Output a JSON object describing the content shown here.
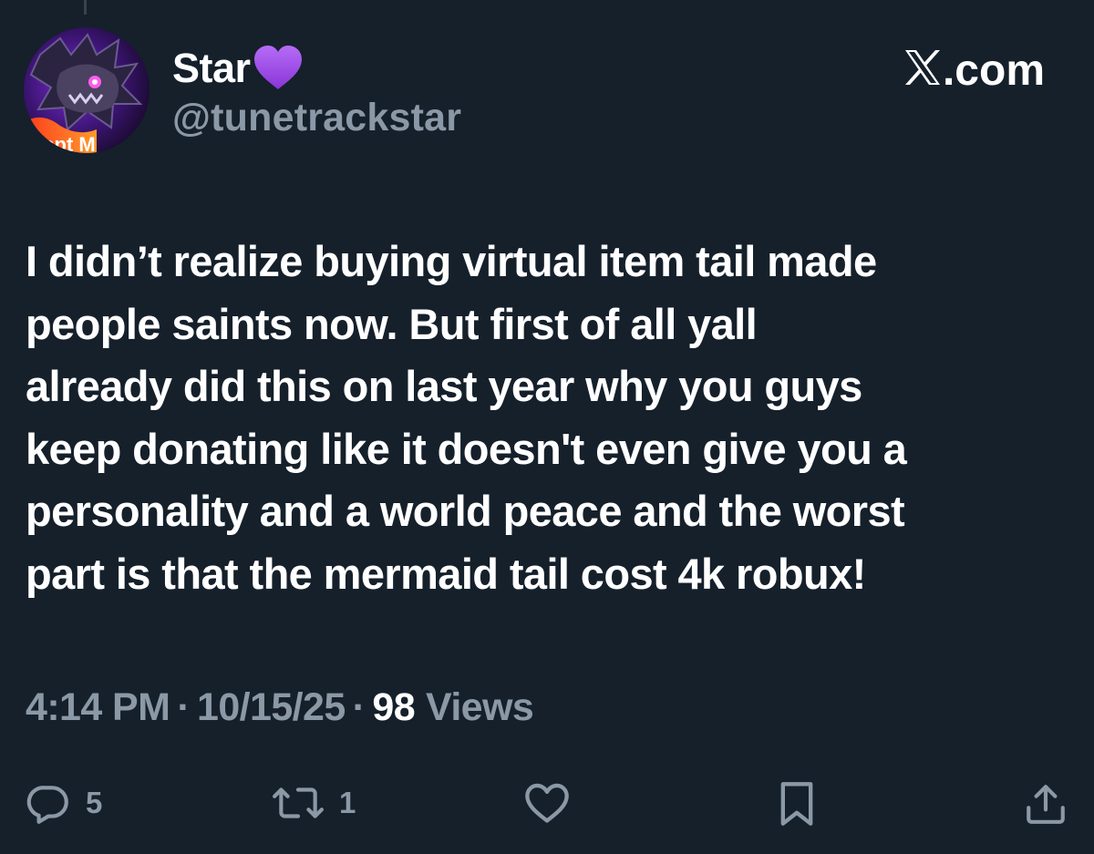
{
  "author": {
    "display_name": "Star",
    "name_emoji": "purple-heart-emoji",
    "handle": "@tunetrackstar",
    "avatar": "avatar-image"
  },
  "site": {
    "label": ".com",
    "logo": "x-logo"
  },
  "tweet": {
    "text": "I didn’t realize buying virtual item tail made\npeople saints now. But first of all yall\nalready did this on last year why you guys\nkeep donating like it doesn't even give you a\npersonality and a world peace and the worst\npart is that the mermaid tail cost 4k robux!"
  },
  "meta": {
    "time": "4:14 PM",
    "separator": "·",
    "date": "10/15/25",
    "views_count": "98",
    "views_label": "Views"
  },
  "actions": {
    "reply": {
      "icon": "reply-icon",
      "count": "5"
    },
    "retweet": {
      "icon": "retweet-icon",
      "count": "1"
    },
    "like": {
      "icon": "heart-icon"
    },
    "bookmark": {
      "icon": "bookmark-icon"
    },
    "share": {
      "icon": "share-icon"
    }
  },
  "colors": {
    "background": "#15202b",
    "text": "#ffffff",
    "secondary_text": "#8b98a5",
    "emoji_purple": "#9b4be0"
  }
}
